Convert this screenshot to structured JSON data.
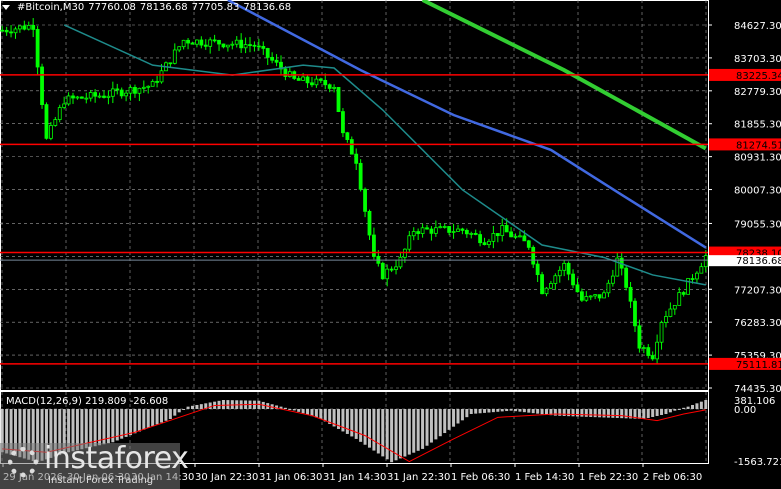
{
  "header": {
    "symbol": "#Bitcoin,M30",
    "open": "77760.08",
    "high": "78136.68",
    "low": "77705.83",
    "close": "78136.68"
  },
  "macd": {
    "label": "MACD(12,26,9)",
    "value": "219.809",
    "signal": "-26.608"
  },
  "watermark": {
    "name": "instaforex",
    "tagline": "Instant Forex Trading"
  },
  "colors": {
    "bg": "#000000",
    "candle": "#00ff00",
    "ma_blue": "#4169e1",
    "ma_teal": "#1e8b8b",
    "ma_green": "#32cd32",
    "level": "#ff0000",
    "macd_hist": "#c0c0c0",
    "macd_signal": "#ff0000",
    "grid": "#a0a0a0"
  },
  "chart_data": {
    "type": "candlestick",
    "bars": 160,
    "price_axis": {
      "min": 74435.3,
      "max": 84627.3,
      "ticks": [
        "84627.30",
        "83703.30",
        "82779.30",
        "81855.30",
        "80931.30",
        "80007.30",
        "79055.30",
        "78130.00",
        "77207.30",
        "76283.30",
        "75359.30",
        "74435.30"
      ]
    },
    "time_labels": [
      "29 Jan 2026",
      "30 Jan 06:30",
      "30 Jan 14:30",
      "30 Jan 22:30",
      "31 Jan 06:30",
      "31 Jan 14:30",
      "31 Jan 22:30",
      "1 Feb 06:30",
      "1 Feb 14:30",
      "1 Feb 22:30",
      "2 Feb 06:30"
    ],
    "levels": [
      {
        "price": 83225.34,
        "label": "83225.34"
      },
      {
        "price": 81274.51,
        "label": "81274.51"
      },
      {
        "price": 78238.1,
        "label": "78238.10"
      },
      {
        "price": 75111.81,
        "label": "75111.81"
      }
    ],
    "current_price": {
      "price": 78136.68,
      "label": "78136.68"
    },
    "price_path": [
      [
        0,
        84480
      ],
      [
        7,
        84620
      ],
      [
        10,
        81400
      ],
      [
        14,
        82520
      ],
      [
        23,
        82660
      ],
      [
        34,
        82940
      ],
      [
        41,
        84200
      ],
      [
        57,
        84060
      ],
      [
        66,
        83080
      ],
      [
        75,
        82940
      ],
      [
        77,
        81540
      ],
      [
        80,
        80840
      ],
      [
        84,
        78030
      ],
      [
        86,
        77610
      ],
      [
        90,
        78030
      ],
      [
        93,
        78870
      ],
      [
        104,
        78870
      ],
      [
        109,
        78590
      ],
      [
        113,
        78870
      ],
      [
        119,
        78450
      ],
      [
        122,
        77190
      ],
      [
        127,
        77890
      ],
      [
        131,
        76900
      ],
      [
        136,
        77050
      ],
      [
        139,
        78030
      ],
      [
        141,
        77330
      ],
      [
        144,
        75640
      ],
      [
        147,
        75360
      ],
      [
        149,
        76340
      ],
      [
        154,
        77190
      ],
      [
        159,
        78137
      ]
    ],
    "ma_slow": [
      [
        51,
        85330
      ],
      [
        81,
        83360
      ],
      [
        102,
        82100
      ],
      [
        124,
        81120
      ],
      [
        140,
        79860
      ],
      [
        159,
        78380
      ]
    ],
    "ma_mid": [
      [
        14,
        84630
      ],
      [
        34,
        83500
      ],
      [
        52,
        83220
      ],
      [
        68,
        83500
      ],
      [
        75,
        83420
      ],
      [
        86,
        82240
      ],
      [
        104,
        80000
      ],
      [
        122,
        78450
      ],
      [
        136,
        78100
      ],
      [
        147,
        77610
      ],
      [
        159,
        77330
      ]
    ],
    "ma_fast": [
      [
        95,
        85330
      ],
      [
        127,
        83360
      ],
      [
        159,
        81160
      ]
    ],
    "macd_axis": {
      "min": -1563.721,
      "max": 381.106,
      "ticks": [
        "381.106",
        "0.00",
        "-1563.721"
      ]
    },
    "macd_hist": [
      [
        0,
        -1300
      ],
      [
        8,
        -1600
      ],
      [
        15,
        -1300
      ],
      [
        25,
        -1000
      ],
      [
        38,
        -300
      ],
      [
        42,
        100
      ],
      [
        50,
        381
      ],
      [
        58,
        350
      ],
      [
        65,
        0
      ],
      [
        72,
        -300
      ],
      [
        80,
        -900
      ],
      [
        88,
        -1600
      ],
      [
        95,
        -1200
      ],
      [
        106,
        -150
      ],
      [
        115,
        -50
      ],
      [
        125,
        -200
      ],
      [
        135,
        -250
      ],
      [
        145,
        -300
      ],
      [
        150,
        -150
      ],
      [
        155,
        100
      ],
      [
        159,
        381
      ]
    ],
    "macd_signal": [
      [
        0,
        -1200
      ],
      [
        10,
        -1300
      ],
      [
        30,
        -700
      ],
      [
        48,
        150
      ],
      [
        58,
        200
      ],
      [
        70,
        -200
      ],
      [
        82,
        -800
      ],
      [
        92,
        -1580
      ],
      [
        102,
        -900
      ],
      [
        112,
        -250
      ],
      [
        125,
        -150
      ],
      [
        140,
        -200
      ],
      [
        148,
        -350
      ],
      [
        154,
        -150
      ],
      [
        159,
        -27
      ]
    ]
  }
}
